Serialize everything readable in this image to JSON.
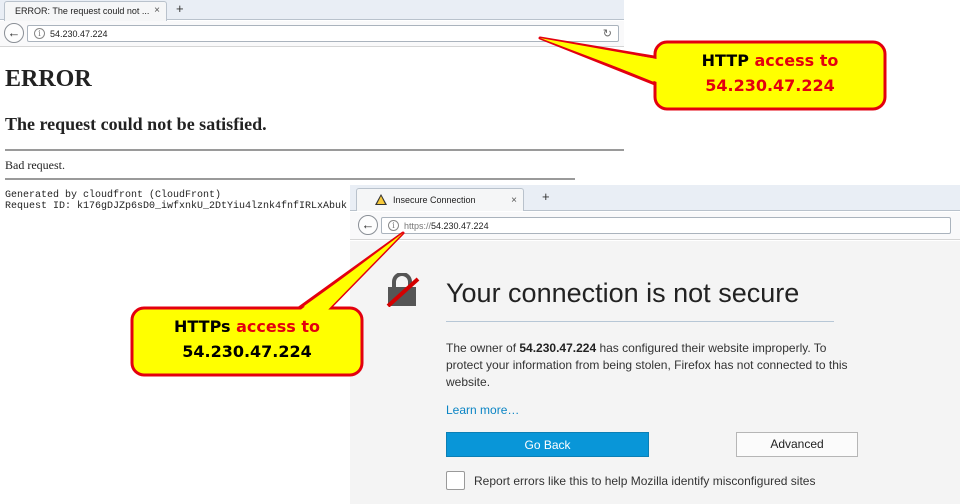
{
  "http_window": {
    "tab_title": "ERROR: The request could not ...",
    "tab_close": "×",
    "new_tab": "+",
    "address": "54.230.47.224",
    "page": {
      "heading": "ERROR",
      "subheading": "The request could not be satisfied.",
      "message": "Bad request.",
      "generated_by": "Generated by cloudfront (CloudFront)",
      "request_id": "Request ID: k176gDJZp6sD0_iwfxnkU_2DtYiu4lznk4fnfIRLxAbuk"
    }
  },
  "https_window": {
    "tab_title": "Insecure Connection",
    "tab_close": "×",
    "new_tab": "+",
    "address_prefix": "https://",
    "address_host": "54.230.47.224",
    "page": {
      "title": "Your connection is not secure",
      "desc_pre": "The owner of ",
      "desc_host": "54.230.47.224",
      "desc_post": " has configured their website improperly. To protect your information from being stolen, Firefox has not connected to this website.",
      "learn_more": "Learn more…",
      "go_back": "Go Back",
      "advanced": "Advanced",
      "report_label": "Report errors like this to help Mozilla identify misconfigured sites",
      "report_checked": false
    }
  },
  "callouts": {
    "http": {
      "word": "HTTP",
      "rest": " access to",
      "host": "54.230.47.224"
    },
    "https": {
      "word": "HTTPs",
      "rest": " access to",
      "host": "54.230.47.224"
    }
  },
  "colors": {
    "callout_fill": "#ffff00",
    "callout_border": "#e3000f",
    "callout_red_text": "#e3000f",
    "primary_button": "#0996d8",
    "link": "#0a84c4"
  },
  "icons": {
    "back": "back-arrow-icon",
    "info": "info-icon",
    "reload": "reload-icon",
    "warning": "warning-triangle-icon",
    "broken_lock": "broken-lock-icon"
  }
}
